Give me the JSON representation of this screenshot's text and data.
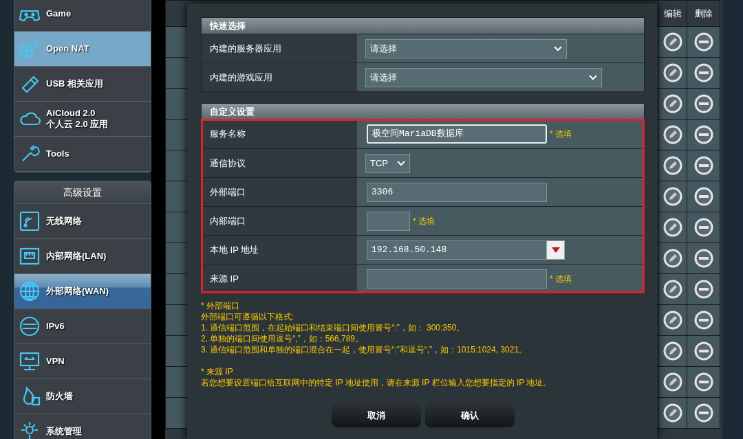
{
  "sidebar": {
    "general_items": [
      {
        "label": "Game",
        "selected": false
      },
      {
        "label": "Open NAT",
        "selected": true
      },
      {
        "label": "USB 相关应用",
        "selected": false
      },
      {
        "label": "AiCloud 2.0\n个人云 2.0 应用",
        "selected": false
      },
      {
        "label": "Tools",
        "selected": false
      }
    ],
    "advanced": {
      "title": "高级设置",
      "items": [
        {
          "label": "无线网络",
          "selected": false
        },
        {
          "label": "内部网络(LAN)",
          "selected": false
        },
        {
          "label": "外部网络(WAN)",
          "selected": true
        },
        {
          "label": "IPv6",
          "selected": false
        },
        {
          "label": "VPN",
          "selected": false
        },
        {
          "label": "防火墙",
          "selected": false
        },
        {
          "label": "系统管理",
          "selected": false
        }
      ]
    }
  },
  "background_table": {
    "columns": [
      "编辑",
      "删除"
    ]
  },
  "dialog": {
    "quick_select": {
      "title": "快速选择",
      "rows": [
        {
          "label": "内建的服务器应用",
          "value": "请选择"
        },
        {
          "label": "内建的游戏应用",
          "value": "请选择"
        }
      ]
    },
    "custom": {
      "title": "自定义设置",
      "highlighted": true,
      "fields": [
        {
          "label": "服务名称",
          "kind": "text",
          "value": "极空间MariaDB数据库",
          "focused": true,
          "hint": "* 选填"
        },
        {
          "label": "通信协议",
          "kind": "select",
          "value": "TCP",
          "focused": false
        },
        {
          "label": "外部端口",
          "kind": "text",
          "value": "3306",
          "focused": false
        },
        {
          "label": "内部端口",
          "kind": "short",
          "focused": false,
          "hint": "* 选填"
        },
        {
          "label": "本地 IP 地址",
          "kind": "combo",
          "value": "192.168.50.148",
          "focused": false
        },
        {
          "label": "来源 IP",
          "kind": "text",
          "focused": false,
          "hint": "* 选填"
        }
      ]
    },
    "notes": [
      [
        "* 外部端口",
        "外部端口可遵循以下格式:",
        "1. 通信端口范围，在起始端口和结束端口间使用冒号“:”，如： 300:350。",
        "2. 单独的端口间使用逗号“,”，如：566,789。",
        "3. 通信端口范围和单独的端口混合在一起，使用冒号“:”和逗号“,”，如：1015:1024, 3021。"
      ],
      [
        "* 来源 IP",
        "若您想要设置端口给互联网中的特定 IP 地址使用，请在来源 IP 栏位输入您想要指定的 IP 地址。"
      ]
    ],
    "buttons": [
      "取消",
      "确认"
    ]
  }
}
